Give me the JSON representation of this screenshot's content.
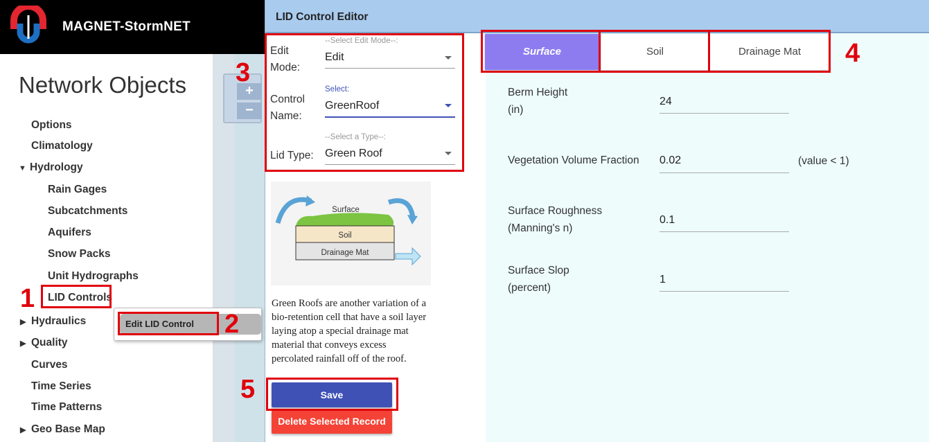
{
  "app": {
    "title": "MAGNET-StormNET"
  },
  "sidebar": {
    "title": "Network Objects",
    "items": [
      {
        "label": "Options"
      },
      {
        "label": "Climatology"
      },
      {
        "label": "Hydrology",
        "caret": "▼"
      },
      {
        "label": "Rain Gages"
      },
      {
        "label": "Subcatchments"
      },
      {
        "label": "Aquifers"
      },
      {
        "label": "Snow Packs"
      },
      {
        "label": "Unit Hydrographs"
      },
      {
        "label": "LID Controls"
      },
      {
        "label": "Hydraulics",
        "caret": "▶"
      },
      {
        "label": "Quality",
        "caret": "▶"
      },
      {
        "label": "Curves"
      },
      {
        "label": "Time Series"
      },
      {
        "label": "Time Patterns"
      },
      {
        "label": "Geo Base Map",
        "caret": "▶"
      }
    ]
  },
  "map": {
    "zoom_in": "+",
    "zoom_out": "−"
  },
  "popup": {
    "item": "Edit LID Control"
  },
  "editor": {
    "title": "LID Control Editor",
    "edit_mode": {
      "label": "Edit Mode:",
      "hint": "--Select Edit Mode--:",
      "value": "Edit"
    },
    "control_name": {
      "label": "Control Name:",
      "hint": "Select:",
      "value": "GreenRoof"
    },
    "lid_type": {
      "label": "Lid Type:",
      "hint": "--Select a Type--:",
      "value": "Green Roof"
    },
    "diagram": {
      "surface": "Surface",
      "soil": "Soil",
      "drainage": "Drainage Mat"
    },
    "description": "Green Roofs are another variation of a bio-retention cell that have a soil layer laying atop a special drainage mat material that conveys excess percolated rainfall off of the roof.",
    "save_label": "Save",
    "delete_label": "Delete Selected Record",
    "tabs": [
      {
        "label": "Surface",
        "active": true
      },
      {
        "label": "Soil",
        "active": false
      },
      {
        "label": "Drainage Mat",
        "active": false
      }
    ],
    "fields": [
      {
        "label_1": "Berm Height",
        "label_2": "(in)",
        "value": "24",
        "hint": ""
      },
      {
        "label_1": "Vegetation Volume Fraction",
        "label_2": "",
        "value": "0.02",
        "hint": "(value < 1)"
      },
      {
        "label_1": "Surface Roughness",
        "label_2": "(Manning's n)",
        "value": "0.1",
        "hint": ""
      },
      {
        "label_1": "Surface Slop",
        "label_2": "(percent)",
        "value": "1",
        "hint": ""
      }
    ]
  },
  "annotations": [
    "1",
    "2",
    "3",
    "4",
    "5"
  ],
  "colors": {
    "accent": "#3f51b5",
    "tab_active": "#8c7cf0",
    "danger": "#f44336",
    "highlight": "#e0000b",
    "header": "#a9cbee"
  }
}
